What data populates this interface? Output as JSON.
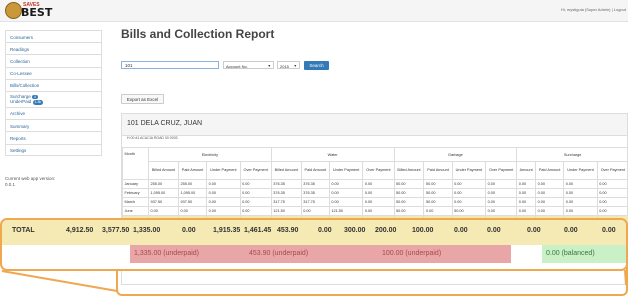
{
  "header": {
    "logo_small": "SAVES",
    "logo_big": "BEST",
    "user_text": "Hi, mystiguia (Super Admin)",
    "logout": "| Logout"
  },
  "sidebar": {
    "items": [
      {
        "label": "Consumers"
      },
      {
        "label": "Readings"
      },
      {
        "label": "Collection"
      },
      {
        "label": "Co-Lessee"
      },
      {
        "label": "Bills/Collection"
      },
      {
        "label": "Surcharge",
        "badge": "4"
      },
      {
        "label": "UnderPaid",
        "badge": "1.5k"
      },
      {
        "label": "Archive"
      },
      {
        "label": "Summary"
      },
      {
        "label": "Reports"
      },
      {
        "label": "Settings"
      }
    ],
    "version_label": "Current web app version:",
    "version": "0.0.1"
  },
  "main": {
    "title": "Bills and Collection Report",
    "search_value": "101",
    "search_by": "Account No.",
    "year": "2015",
    "search_label": "Search",
    "export_label": "Export as Excel",
    "consumer_name": "101 DELA CRUZ, JUAN",
    "consumer_address": "H 00 #1 ACACIA ROAD 00 0003"
  },
  "table": {
    "month_header": "Month",
    "groups": [
      "Electricity",
      "Water",
      "Garbage",
      "Surcharge"
    ],
    "subheaders": [
      "Billed Amount",
      "Paid Amount",
      "Under Payment",
      "Over Payment"
    ],
    "surcharge_subheaders": [
      "Amount",
      "Paid Amount",
      "Under Payment",
      "Over Payment"
    ],
    "rows": [
      {
        "month": "January",
        "cells": [
          "255.00",
          "255.00",
          "0.00",
          "0.00",
          "376.35",
          "376.35",
          "0.00",
          "0.00",
          "50.00",
          "50.00",
          "0.00",
          "0.00",
          "0.00",
          "0.00",
          "0.00",
          "0.00"
        ]
      },
      {
        "month": "February",
        "cells": [
          "1,095.00",
          "1,095.00",
          "0.00",
          "0.00",
          "376.35",
          "376.35",
          "0.00",
          "0.00",
          "50.00",
          "50.00",
          "0.00",
          "0.00",
          "0.00",
          "0.00",
          "0.00",
          "0.00"
        ]
      },
      {
        "month": "March",
        "cells": [
          "937.50",
          "937.50",
          "0.00",
          "0.00",
          "317.75",
          "317.75",
          "0.00",
          "0.00",
          "50.00",
          "50.00",
          "0.00",
          "0.00",
          "0.00",
          "0.00",
          "0.00",
          "0.00"
        ]
      },
      {
        "month": "June",
        "cells": [
          "0.00",
          "0.00",
          "0.00",
          "0.00",
          "121.50",
          "0.00",
          "121.50",
          "0.00",
          "50.00",
          "0.00",
          "50.00",
          "0.00",
          "0.00",
          "0.00",
          "0.00",
          "0.00"
        ]
      }
    ],
    "total": {
      "label": "TOTAL",
      "cells": [
        "4,912.50",
        "3,577.50",
        "1,335.00",
        "0.00",
        "1,915.35",
        "1,461.45",
        "453.90",
        "0.00",
        "300.00",
        "200.00",
        "100.00",
        "0.00",
        "0.00",
        "0.00",
        "0.00",
        "0.00"
      ]
    },
    "status": [
      "1,335.00 (underpaid)",
      "453.90 (underpaid)",
      "100.00 (underpaid)",
      "0.00 (balanced)"
    ]
  },
  "colors": {
    "underpaid_bg": "#e8a6a6",
    "balanced_bg": "#c9f0c6",
    "total_bg": "#f5e9b4",
    "callout": "#f0a850",
    "primary": "#337ab7"
  }
}
